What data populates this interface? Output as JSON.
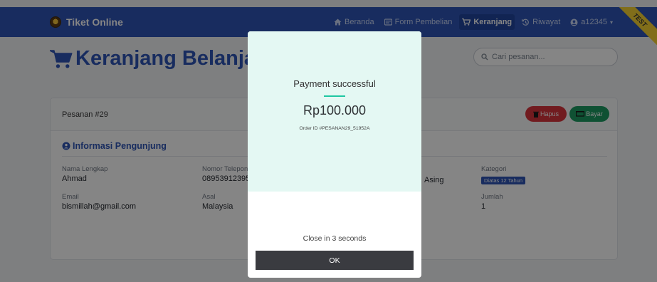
{
  "navbar": {
    "brand": "Tiket Online",
    "items": [
      {
        "label": "Beranda"
      },
      {
        "label": "Form Pembelian"
      },
      {
        "label": "Keranjang"
      },
      {
        "label": "Riwayat"
      },
      {
        "label": "a12345"
      }
    ],
    "ribbon": "TEST"
  },
  "page": {
    "title": "Keranjang Belanja",
    "search_placeholder": "Cari pesanan..."
  },
  "order": {
    "header": "Pesanan #29",
    "delete_label": "Hapus",
    "pay_label": "Bayar",
    "section_title": "Informasi Pengunjung",
    "fields": {
      "name_label": "Nama Lengkap",
      "name_value": "Ahmad",
      "phone_label": "Nomor Telepon",
      "phone_value": "08953912395",
      "type_value": "Asing",
      "category_label": "Kategori",
      "category_value": "Diatas 12 Tahun",
      "email_label": "Email",
      "email_value": "bismillah@gmail.com",
      "origin_label": "Asal",
      "origin_value": "Malaysia",
      "qty_label": "Jumlah",
      "qty_value": "1"
    }
  },
  "modal": {
    "title": "Payment successful",
    "amount": "Rp100.000",
    "order_id": "Order ID #PESANAN29_51952A",
    "close_text": "Close in 3 seconds",
    "ok_label": "OK"
  },
  "colors": {
    "primary": "#2e55b6",
    "danger": "#d9343c",
    "success": "#1e9b63",
    "modal_accent": "#1ec7a2",
    "ribbon": "#f7d332"
  }
}
